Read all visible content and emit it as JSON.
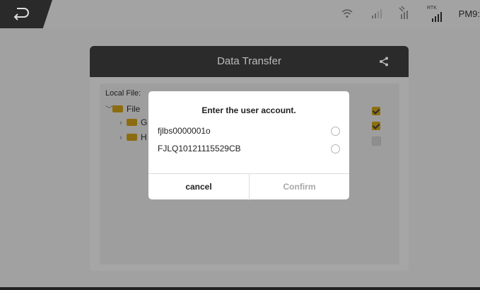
{
  "statusbar": {
    "time": "PM9:",
    "rtk_label": "RTK"
  },
  "panel": {
    "title": "Data Transfer"
  },
  "tree": {
    "local_file_label": "Local File:",
    "root": "File",
    "children": [
      "G",
      "H"
    ]
  },
  "dialog": {
    "title": "Enter the user account.",
    "accounts": [
      "fjlbs0000001o",
      "FJLQ10121115529CB"
    ],
    "cancel": "cancel",
    "confirm": "Confirm"
  }
}
